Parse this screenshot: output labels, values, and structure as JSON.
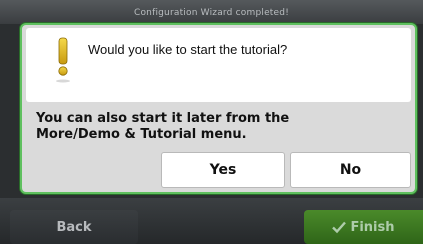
{
  "background": {
    "title": "Configuration Wizard completed!",
    "back_label": "Back",
    "finish_label": "Finish",
    "finish_icon": "checkmark-icon"
  },
  "dialog": {
    "icon": "warning-exclamation-icon",
    "question": "Would you like to start the tutorial?",
    "info_line1": "You can also start it later from the",
    "info_line2": "More/Demo & Tutorial menu.",
    "yes_label": "Yes",
    "no_label": "No"
  },
  "colors": {
    "dialog_border": "#5fc05f",
    "finish_green": "#3f7d22",
    "warning_yellow": "#e8c21a"
  }
}
